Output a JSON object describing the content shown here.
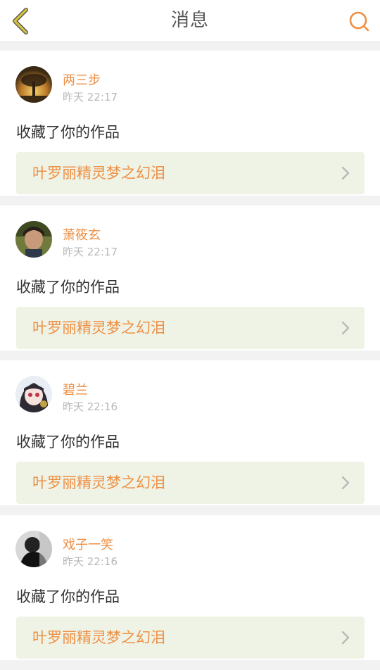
{
  "header": {
    "title": "消息",
    "back_icon": "chevron-left-icon",
    "search_icon": "search-icon",
    "accent": "#ef8f43",
    "back_color": "#d9c23c"
  },
  "messages": [
    {
      "username": "两三步",
      "time": "昨天 22:17",
      "action": "收藏了你的作品",
      "work_title": "叶罗丽精灵梦之幻泪",
      "avatar": "tree-sunset-avatar"
    },
    {
      "username": "萧筱玄",
      "time": "昨天 22:17",
      "action": "收藏了你的作品",
      "work_title": "叶罗丽精灵梦之幻泪",
      "avatar": "portrait-avatar"
    },
    {
      "username": "碧兰",
      "time": "昨天 22:16",
      "action": "收藏了你的作品",
      "work_title": "叶罗丽精灵梦之幻泪",
      "avatar": "anime-girl-avatar"
    },
    {
      "username": "戏子一笑",
      "time": "昨天 22:16",
      "action": "收藏了你的作品",
      "work_title": "叶罗丽精灵梦之幻泪",
      "avatar": "monochrome-avatar"
    }
  ]
}
